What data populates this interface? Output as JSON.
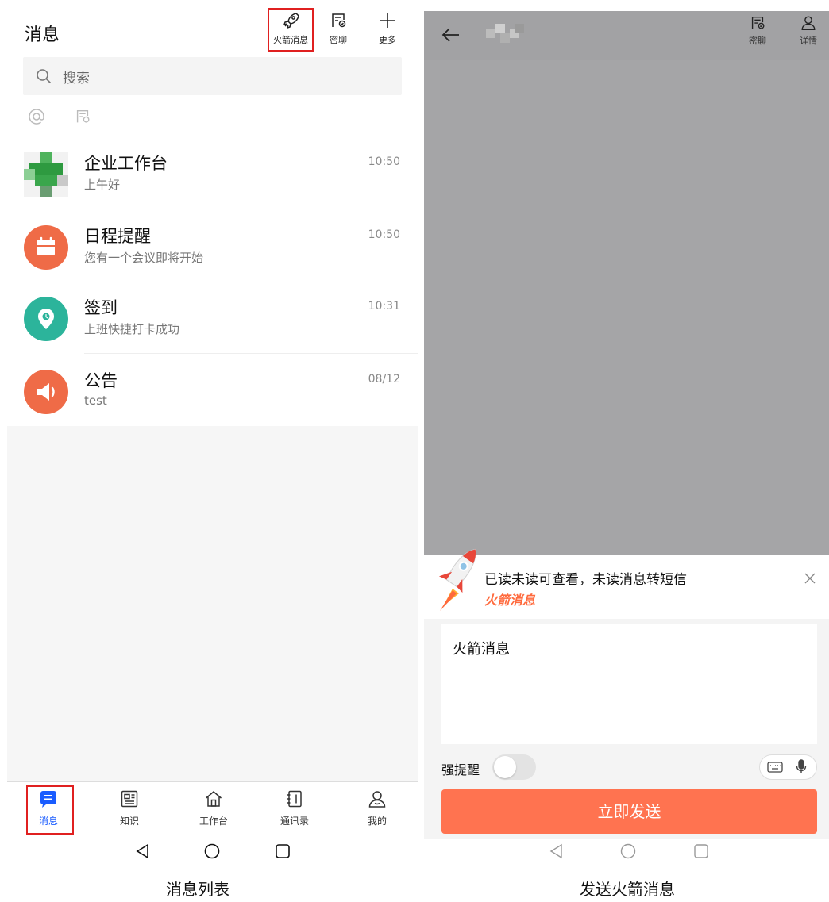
{
  "left": {
    "title": "消息",
    "actions": [
      {
        "label": "火箭消息",
        "icon": "rocket-icon"
      },
      {
        "label": "密聊",
        "icon": "secret-chat-icon"
      },
      {
        "label": "更多",
        "icon": "plus-icon"
      }
    ],
    "search_placeholder": "搜索",
    "chats": [
      {
        "name": "企业工作台",
        "preview": "上午好",
        "time": "10:50",
        "avatar_color": "#3aa64c"
      },
      {
        "name": "日程提醒",
        "preview": "您有一个会议即将开始",
        "time": "10:50",
        "avatar_color": "#ef6b47"
      },
      {
        "name": "签到",
        "preview": "上班快捷打卡成功",
        "time": "10:31",
        "avatar_color": "#2cb49b"
      },
      {
        "name": "公告",
        "preview": "test",
        "time": "08/12",
        "avatar_color": "#ef6b47"
      }
    ],
    "tabs": [
      {
        "label": "消息",
        "icon": "message-icon",
        "active": true
      },
      {
        "label": "知识",
        "icon": "knowledge-icon"
      },
      {
        "label": "工作台",
        "icon": "home-icon"
      },
      {
        "label": "通讯录",
        "icon": "contacts-icon"
      },
      {
        "label": "我的",
        "icon": "profile-icon"
      }
    ],
    "caption": "消息列表"
  },
  "right": {
    "actions": [
      {
        "label": "密聊",
        "icon": "secret-chat-icon"
      },
      {
        "label": "详情",
        "icon": "person-icon"
      }
    ],
    "sheet": {
      "description": "已读未读可查看，未读消息转短信",
      "tag": "火箭消息",
      "message": "火箭消息",
      "strong_reminder_label": "强提醒",
      "strong_reminder_on": false,
      "send_label": "立即发送"
    },
    "caption": "发送火箭消息"
  },
  "colors": {
    "accent_blue": "#1a5cff",
    "send_orange": "#ff7350",
    "highlight_red": "#e02020",
    "tag_orange": "#ff6a3d"
  }
}
